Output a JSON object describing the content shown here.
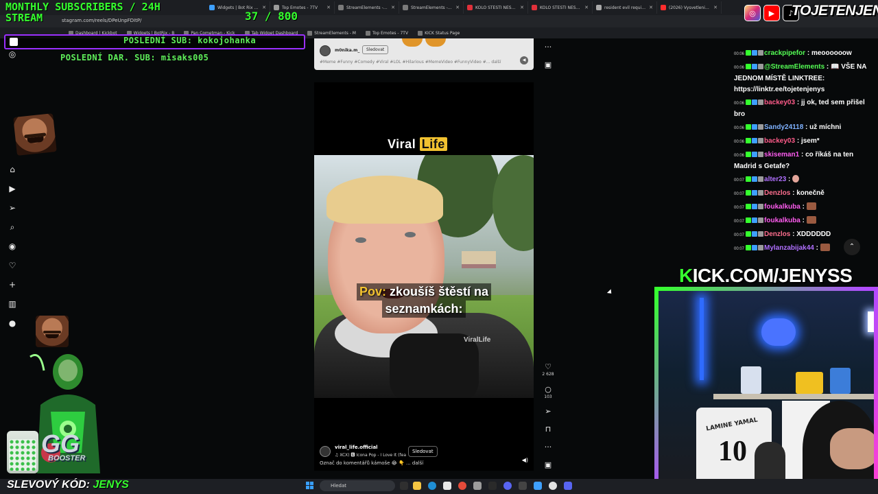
{
  "browser": {
    "tabs": [
      {
        "title": "Widgets | Bot Rix — C",
        "favicon_color": "#3ea0ff"
      },
      {
        "title": "Top Emotes - 7TV",
        "favicon_color": "#9b9b9b"
      },
      {
        "title": "StreamElements - Tim",
        "favicon_color": "#7a7a7a"
      },
      {
        "title": "StreamElements - Ele",
        "favicon_color": "#7a7a7a"
      },
      {
        "title": "KOLO ŠTĚSTÍ NEŠTĚSTÍ",
        "favicon_color": "#e0303a"
      },
      {
        "title": "KOLO ŠTĚSTÍ NEŠTĚSTÍ",
        "favicon_color": "#e0303a"
      },
      {
        "title": "resident evil requiem",
        "favicon_color": "#aaaaaa"
      },
      {
        "title": "(2026) Vysvetlenie Ep",
        "favicon_color": "#ff2d2d"
      }
    ],
    "url": "stagram.com/reels/DPeUnpFDItP/",
    "bookmarks": [
      "Dashboard | Kickbot",
      "Widgets | BotRix - B",
      "Pan Cometman - Kick",
      "Tab Widget Dashboard",
      "StreamElements - M",
      "Top Emotes - 7TV",
      "KICK Status Page"
    ]
  },
  "overlay": {
    "title_line1": "MONTHLY SUBSCRIBERS / 24H",
    "title_line2": "STREAM",
    "sub_count": "37 / 800",
    "last_sub": "POSLEDNÍ SUB: kokojohanka",
    "last_gift": "POSLEDNÍ DAR. SUB: misaks005",
    "code_label": "SLEVOVÝ KÓD:",
    "code_value": "JENYS",
    "booster_text": "BOOSTER",
    "booster_logo": "GG",
    "kick_url_k": "K",
    "kick_url_rest": "ICK.COM/JENYSS",
    "brand_name": "TOJETENJENYS",
    "jersey_name": "LAMINE YAMAL",
    "jersey_number": "10"
  },
  "feed": {
    "top_post": {
      "user": "m0nika.m_",
      "follow": "Sledovat",
      "tags": "#Meme #Funny #Comedy #Viral #LOL #Hilarious #MemeVideo #FunnyVideo #... další"
    },
    "reel": {
      "brand_viral": "Viral",
      "brand_life": "Life",
      "watermark": "ViralLife",
      "caption_pov": "Pov:",
      "caption_line1_rest": " zkoušíš štěstí na",
      "caption_line2": "seznamkách:",
      "user": "viral_life.official",
      "song": "♫ XCX) 🅴 Icona Pop - I Love It (fea",
      "follow": "Sledovat",
      "description": "Označ do komentářů kámoše 😂 👇 ... další"
    },
    "actions": {
      "likes": "2 628",
      "comments": "103"
    }
  },
  "chat": [
    {
      "time": "00:06",
      "user": "crackpipefor",
      "color": "#55ff55",
      "text": "meoooooow",
      "emote": ""
    },
    {
      "time": "00:06",
      "user": "@StreamElements",
      "color": "#55ff55",
      "text": "📖 VŠE NA JEDNOM MÍSTĚ LINKTREE: https://linktr.ee/tojetenjenys",
      "emote": ""
    },
    {
      "time": "00:06",
      "user": "backey03",
      "color": "#ff5c8a",
      "text": "jj ok, ted sem přišel bro",
      "emote": ""
    },
    {
      "time": "00:06",
      "user": "Sandy24118",
      "color": "#7fb2ff",
      "text": "už míchni",
      "emote": ""
    },
    {
      "time": "00:06",
      "user": "backey03",
      "color": "#ff5c8a",
      "text": "jsem*",
      "emote": ""
    },
    {
      "time": "00:06",
      "user": "skiseman1",
      "color": "#ff5cf0",
      "text": "co říkáš na ten Madrid s Getafe?",
      "emote": ""
    },
    {
      "time": "00:07",
      "user": "alter23",
      "color": "#b070ff",
      "text": "",
      "emote": "round"
    },
    {
      "time": "00:07",
      "user": "Denzlos",
      "color": "#ff6f8f",
      "text": "konečně",
      "emote": ""
    },
    {
      "time": "00:07",
      "user": "foukalkuba",
      "color": "#ff5cf0",
      "text": "",
      "emote": "square"
    },
    {
      "time": "00:07",
      "user": "foukalkuba",
      "color": "#ff5cf0",
      "text": "",
      "emote": "square"
    },
    {
      "time": "00:07",
      "user": "Denzlos",
      "color": "#ff6f8f",
      "text": "XDDDDDD",
      "emote": ""
    },
    {
      "time": "00:07",
      "user": "Mylanzabijak44",
      "color": "#b070ff",
      "text": "",
      "emote": "square"
    }
  ],
  "taskbar": {
    "search_placeholder": "Hledat"
  },
  "colors": {
    "accent_green": "#35ff2e",
    "accent_purple": "#9b30ff"
  }
}
